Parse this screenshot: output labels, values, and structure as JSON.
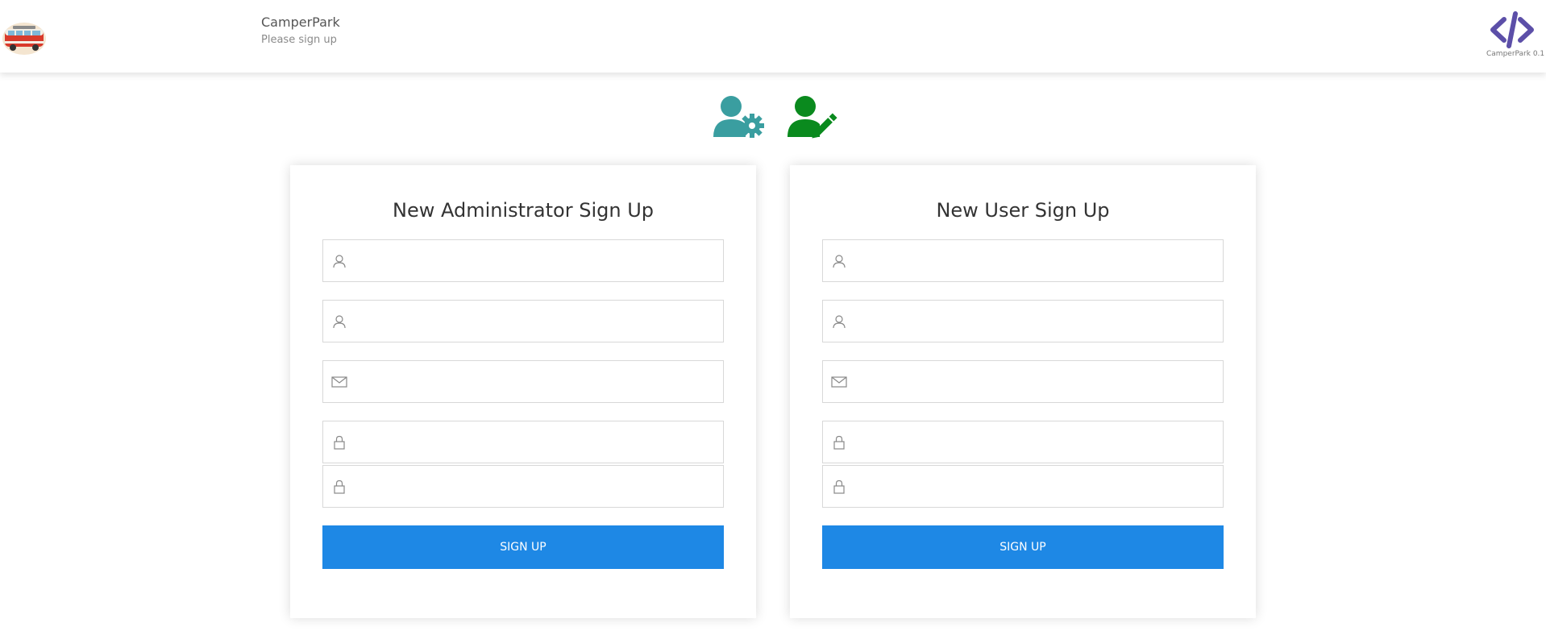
{
  "header": {
    "app_name": "CamperPark",
    "subtitle": "Please sign up",
    "version": "CamperPark 0.1",
    "logo_icon": "camper-van-icon",
    "version_icon": "code-brackets-icon"
  },
  "role_icons": {
    "admin": {
      "icon": "user-gear-icon",
      "color": "#3a9ea0"
    },
    "user": {
      "icon": "user-edit-icon",
      "color": "#0a8a1e"
    }
  },
  "admin_form": {
    "title": "New Administrator Sign Up",
    "fields": [
      {
        "icon": "user-icon",
        "value": "",
        "placeholder": ""
      },
      {
        "icon": "user-icon",
        "value": "",
        "placeholder": ""
      },
      {
        "icon": "envelope-icon",
        "value": "",
        "placeholder": ""
      },
      {
        "icon": "lock-icon",
        "value": "",
        "placeholder": ""
      },
      {
        "icon": "lock-icon",
        "value": "",
        "placeholder": ""
      }
    ],
    "submit_label": "SIGN UP"
  },
  "user_form": {
    "title": "New User Sign Up",
    "fields": [
      {
        "icon": "user-icon",
        "value": "",
        "placeholder": ""
      },
      {
        "icon": "user-icon",
        "value": "",
        "placeholder": ""
      },
      {
        "icon": "envelope-icon",
        "value": "",
        "placeholder": ""
      },
      {
        "icon": "lock-icon",
        "value": "",
        "placeholder": ""
      },
      {
        "icon": "lock-icon",
        "value": "",
        "placeholder": ""
      }
    ],
    "submit_label": "SIGN UP"
  },
  "colors": {
    "primary_button": "#1e88e5",
    "accent_purple": "#5c4fa8"
  }
}
